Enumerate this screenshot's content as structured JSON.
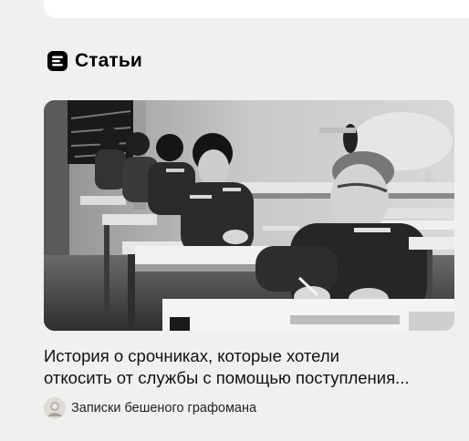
{
  "section": {
    "icon": "article-icon",
    "title": "Статьи"
  },
  "article": {
    "title": "История о срочниках, которые хотели\nоткосить от службы с помощью поступления...",
    "image": "black-and-white photo of young soldiers in uniform writing exams at school desks",
    "source": {
      "avatar": "author-avatar",
      "name": "Записки бешеного графомана"
    }
  },
  "colors": {
    "page_background": "#f0f0ef",
    "card_background": "#ffffff",
    "text": "#111111"
  }
}
